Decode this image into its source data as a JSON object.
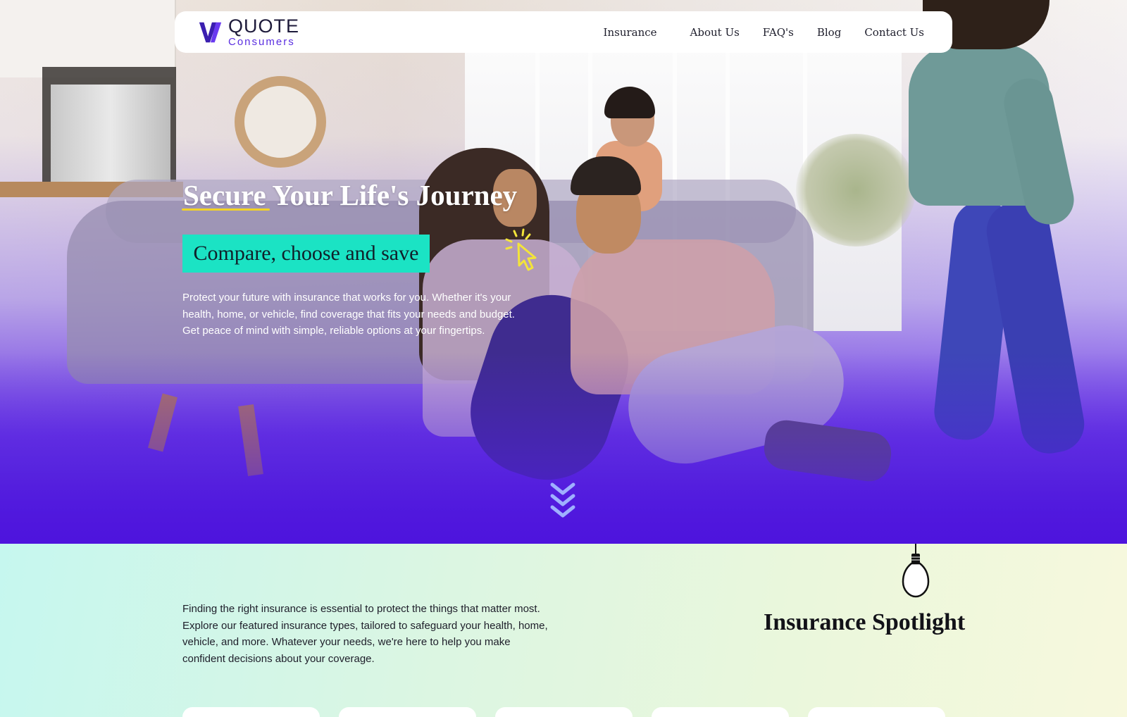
{
  "nav": {
    "logo_title": "QUOTE",
    "logo_sub": "Consumers",
    "links": [
      "Insurance",
      "About Us",
      "FAQ's",
      "Blog",
      "Contact Us"
    ]
  },
  "hero": {
    "title": "Secure Your Life's Journey",
    "badge": "Compare, choose and save",
    "description": "Protect your future with insurance that works for you. Whether it's your health, home, or vehicle, find coverage that fits your needs and budget. Get peace of mind with simple, reliable options at your fingertips."
  },
  "spotlight": {
    "intro": "Finding the right insurance is essential to protect the things that matter most. Explore our featured insurance types, tailored to safeguard your health, home, vehicle, and more. Whatever your needs, we're here to help you make confident decisions about your coverage.",
    "title": "Insurance Spotlight"
  },
  "colors": {
    "brand_purple": "#5a2ee0",
    "hero_gradient_end": "#4f14dd",
    "badge_teal": "#1be3c4",
    "accent_yellow": "#f3d324"
  },
  "icons": [
    "logo-mark-icon",
    "cursor-click-icon",
    "chevron-down-icon",
    "lightbulb-icon"
  ]
}
